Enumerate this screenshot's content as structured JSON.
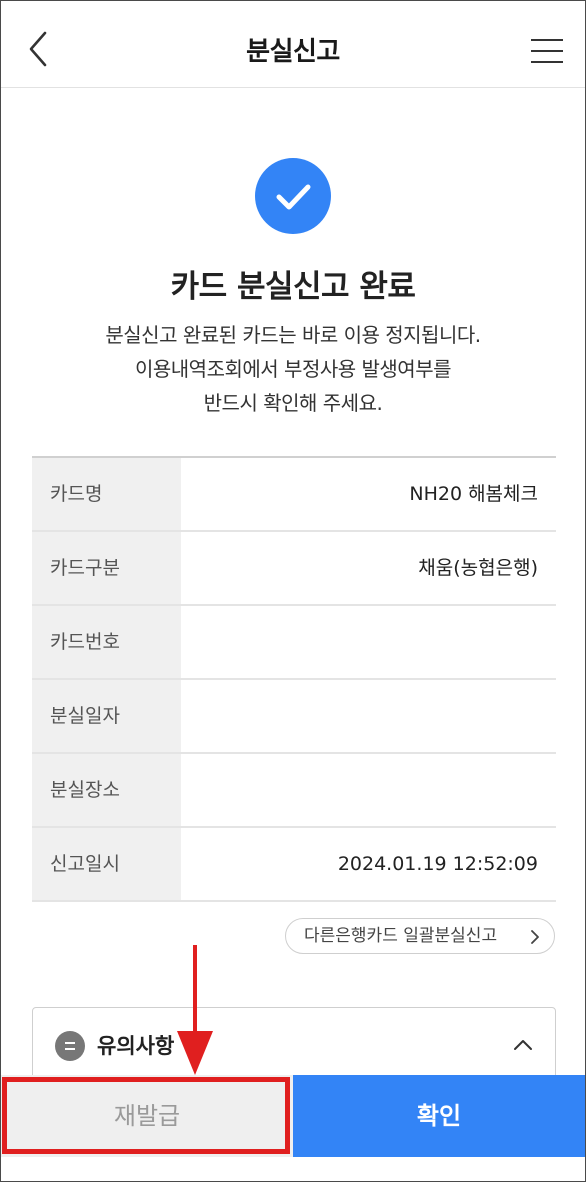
{
  "header": {
    "title": "분실신고",
    "back_icon": "chevron-left-icon",
    "menu_icon": "hamburger-menu-icon"
  },
  "success": {
    "icon": "check-circle-icon",
    "title": "카드 분실신고 완료",
    "description_lines": [
      "분실신고 완료된 카드는 바로 이용 정지됩니다.",
      "이용내역조회에서 부정사용 발생여부를",
      "반드시 확인해 주세요."
    ]
  },
  "info_table": {
    "rows": [
      {
        "label": "카드명",
        "value": "NH20 해봄체크"
      },
      {
        "label": "카드구분",
        "value": "채움(농협은행)"
      },
      {
        "label": "카드번호",
        "value": ""
      },
      {
        "label": "분실일자",
        "value": ""
      },
      {
        "label": "분실장소",
        "value": ""
      },
      {
        "label": "신고일시",
        "value": "2024.01.19 12:52:09"
      }
    ]
  },
  "other_bank_button": {
    "label": "다른은행카드 일괄분실신고",
    "icon": "chevron-right-icon"
  },
  "notice": {
    "title": "유의사항",
    "icon": "list-circle-icon",
    "toggle_icon": "chevron-up-icon"
  },
  "bottom_buttons": {
    "reissue_label": "재발급",
    "confirm_label": "확인"
  },
  "colors": {
    "accent": "#3384f6",
    "annotation": "#e01f1f",
    "table_header_bg": "#f0f0f0"
  }
}
